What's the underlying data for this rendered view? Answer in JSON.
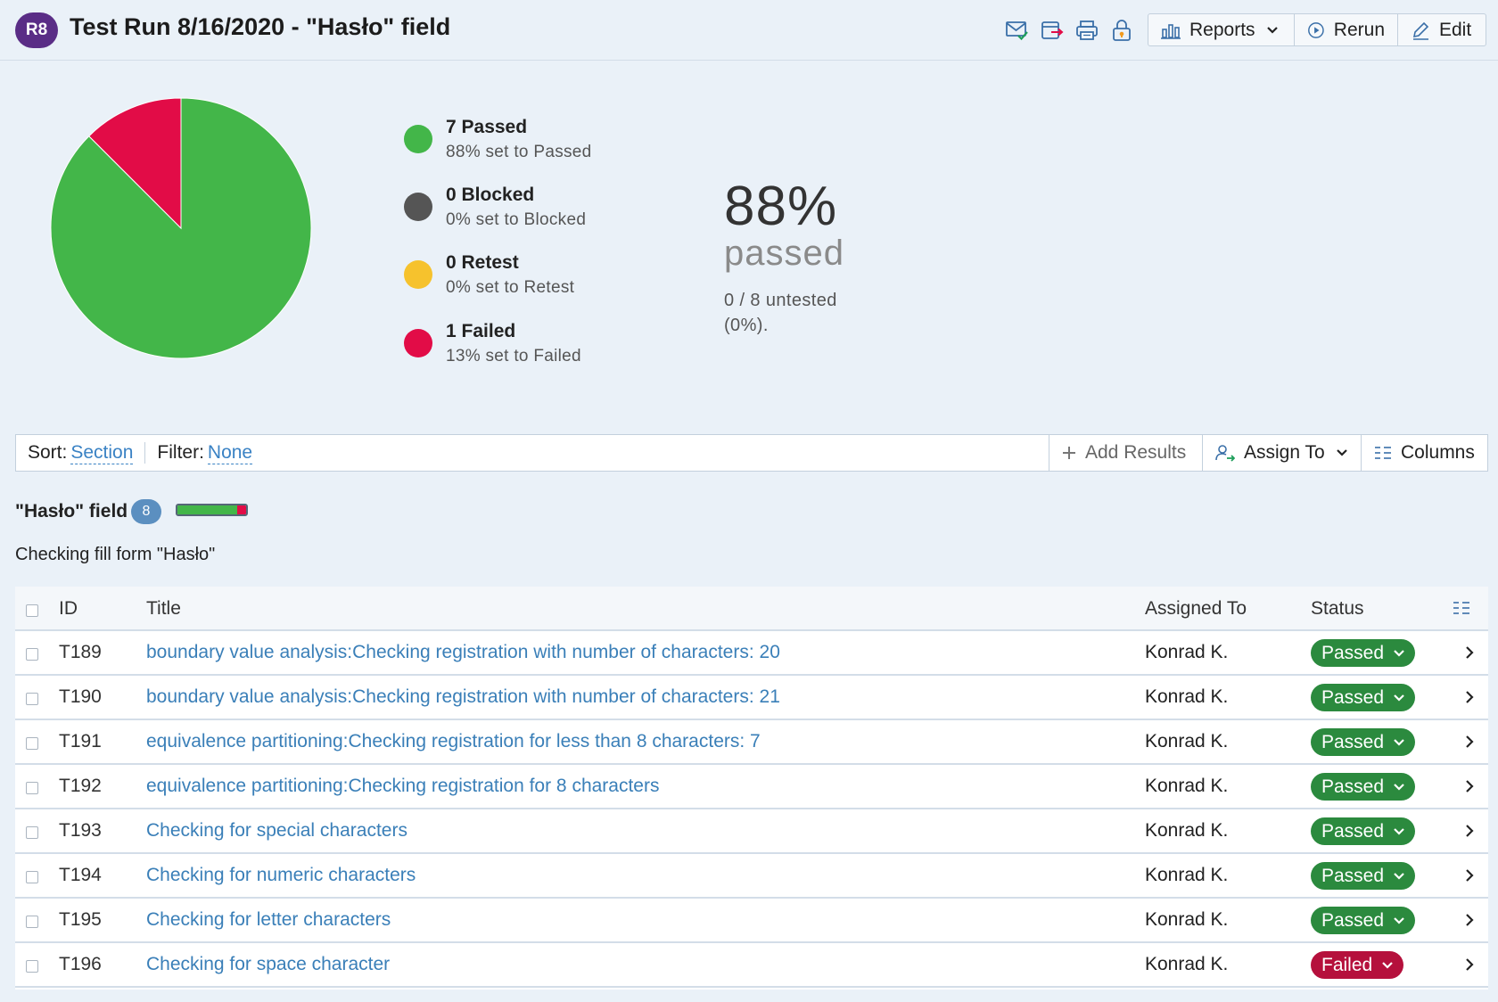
{
  "header": {
    "run_id": "R8",
    "title": "Test Run 8/16/2020 - \"Hasło\" field",
    "reports_label": "Reports",
    "rerun_label": "Rerun",
    "edit_label": "Edit"
  },
  "summary": {
    "legend": [
      {
        "title": "7 Passed",
        "sub": "88% set to Passed",
        "color": "#43b649"
      },
      {
        "title": "0 Blocked",
        "sub": "0% set to Blocked",
        "color": "#555555"
      },
      {
        "title": "0 Retest",
        "sub": "0% set to Retest",
        "color": "#f6c22d"
      },
      {
        "title": "1 Failed",
        "sub": "13% set to Failed",
        "color": "#e20c47"
      }
    ],
    "percent": "88%",
    "percent_label": "passed",
    "untested": "0 / 8 untested (0%)."
  },
  "chart_data": {
    "type": "pie",
    "categories": [
      "Passed",
      "Blocked",
      "Retest",
      "Failed"
    ],
    "values": [
      7,
      0,
      0,
      1
    ],
    "colors": [
      "#43b649",
      "#555555",
      "#f6c22d",
      "#e20c47"
    ]
  },
  "toolbar": {
    "sort_label": "Sort:",
    "sort_value": "Section",
    "filter_label": "Filter:",
    "filter_value": "None",
    "add_results_label": "Add Results",
    "assign_to_label": "Assign To",
    "columns_label": "Columns"
  },
  "section": {
    "title": "\"Hasło\" field",
    "count": "8",
    "description": "Checking fill form \"Hasło\"",
    "progress": {
      "passed": 7,
      "failed": 1,
      "total": 8
    }
  },
  "table": {
    "columns": {
      "id": "ID",
      "title": "Title",
      "assigned": "Assigned To",
      "status": "Status"
    },
    "status_colors": {
      "Passed": "#2b8a3e",
      "Failed": "#b5103c"
    },
    "rows": [
      {
        "id": "T189",
        "title": "boundary value analysis:Checking registration with number of characters: 20",
        "assigned": "Konrad K.",
        "status": "Passed"
      },
      {
        "id": "T190",
        "title": "boundary value analysis:Checking registration with number of characters: 21",
        "assigned": "Konrad K.",
        "status": "Passed"
      },
      {
        "id": "T191",
        "title": "equivalence partitioning:Checking registration for less than 8 characters: 7",
        "assigned": "Konrad K.",
        "status": "Passed"
      },
      {
        "id": "T192",
        "title": "equivalence partitioning:Checking registration for 8 characters",
        "assigned": "Konrad K.",
        "status": "Passed"
      },
      {
        "id": "T193",
        "title": "Checking for special characters",
        "assigned": "Konrad K.",
        "status": "Passed"
      },
      {
        "id": "T194",
        "title": "Checking for numeric characters",
        "assigned": "Konrad K.",
        "status": "Passed"
      },
      {
        "id": "T195",
        "title": "Checking for letter characters",
        "assigned": "Konrad K.",
        "status": "Passed"
      },
      {
        "id": "T196",
        "title": "Checking for space character",
        "assigned": "Konrad K.",
        "status": "Failed"
      }
    ]
  }
}
